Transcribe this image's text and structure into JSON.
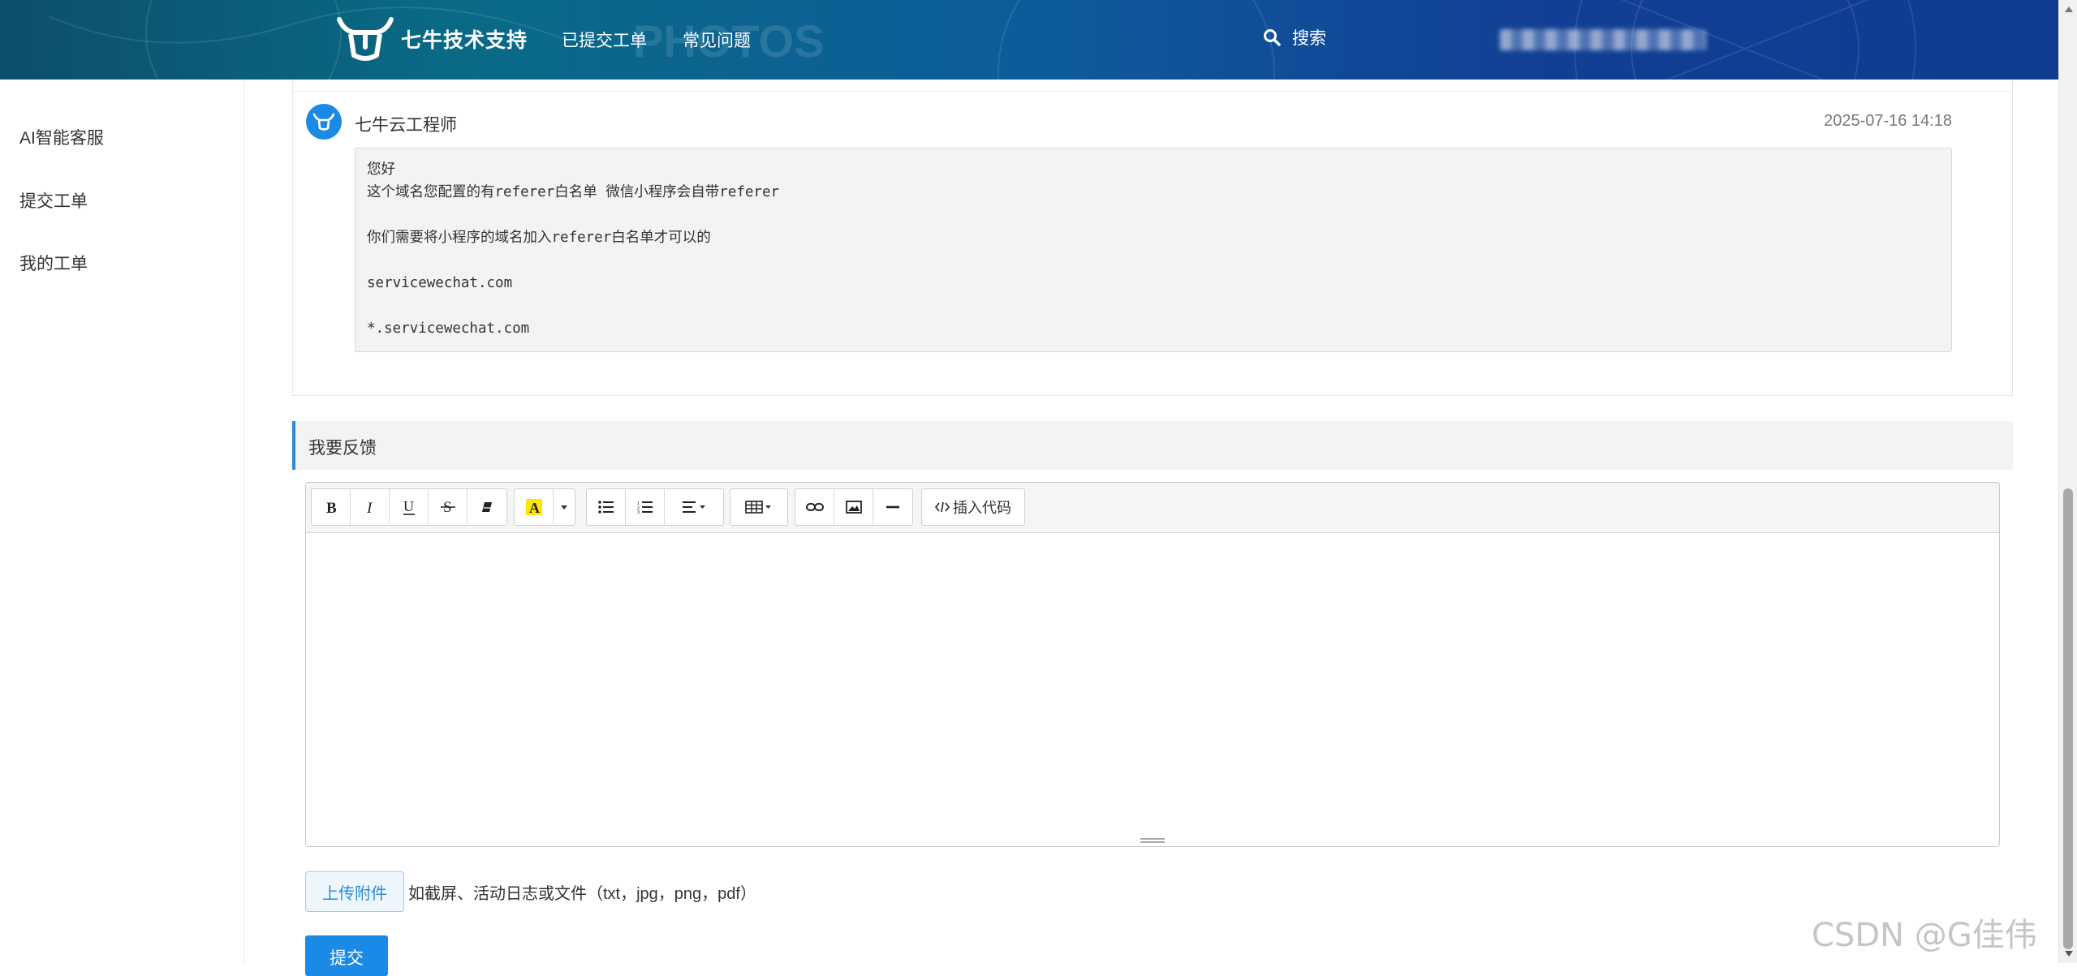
{
  "header": {
    "brand": "七牛技术支持",
    "nav": [
      "已提交工单",
      "常见问题"
    ],
    "search_label": "搜索",
    "user_name": "",
    "watermark_text": "PHOTOS"
  },
  "sidebar": {
    "items": [
      {
        "label": "AI智能客服"
      },
      {
        "label": "提交工单"
      },
      {
        "label": "我的工单"
      }
    ]
  },
  "reply": {
    "author": "七牛云工程师",
    "timestamp": "2025-07-16 14:18",
    "lines": [
      "您好",
      "这个域名您配置的有referer白名单 微信小程序会自带referer",
      "",
      "你们需要将小程序的域名加入referer白名单才可以的",
      "",
      "servicewechat.com",
      "",
      "*.servicewechat.com"
    ]
  },
  "feedback": {
    "title": "我要反馈",
    "insert_code_label": "插入代码",
    "upload_label": "上传附件",
    "upload_hint": "如截屏、活动日志或文件（txt，jpg，png，pdf）",
    "submit_label": "提交"
  },
  "watermark": "CSDN @G佳伟",
  "colors": {
    "accent": "#1a8ae6",
    "header_start": "#0c4f6a",
    "header_end": "#0f3c8e",
    "highlight_yellow": "#ffe600"
  }
}
